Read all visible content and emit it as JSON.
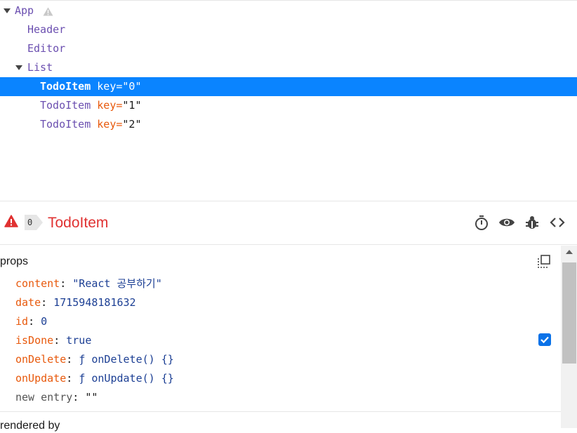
{
  "tree": {
    "rows": [
      {
        "name": "App"
      },
      {
        "name": "Header"
      },
      {
        "name": "Editor"
      },
      {
        "name": "List"
      },
      {
        "name": "TodoItem",
        "key_label": "key=",
        "key_value": "\"0\""
      },
      {
        "name": "TodoItem",
        "key_label": "key=",
        "key_value": "\"1\""
      },
      {
        "name": "TodoItem",
        "key_label": "key=",
        "key_value": "\"2\""
      }
    ]
  },
  "inspector": {
    "badge_count": "0",
    "component_name": "TodoItem",
    "props_heading": "props",
    "props": [
      {
        "name": "content",
        "value": "\"React 공부하기\""
      },
      {
        "name": "date",
        "value": "1715948181632"
      },
      {
        "name": "id",
        "value": "0"
      },
      {
        "name": "isDone",
        "value": "true"
      },
      {
        "name": "onDelete",
        "value": "ƒ onDelete() {}"
      },
      {
        "name": "onUpdate",
        "value": "ƒ onUpdate() {}"
      }
    ],
    "new_entry": {
      "name": "new entry",
      "value": "\"\""
    },
    "rendered_by_heading": "rendered by",
    "isDone_checked": true
  },
  "icons": {
    "warning": "warning-icon",
    "timer": "stopwatch-icon",
    "eye": "eye-icon",
    "bug": "bug-icon",
    "code": "code-icon",
    "copy": "copy-icon"
  },
  "colors": {
    "selection": "#0a84ff",
    "component_name": "#6b4fb0",
    "prop_key": "#e8590c",
    "prop_value": "#1c3f94",
    "title_red": "#e03131"
  }
}
